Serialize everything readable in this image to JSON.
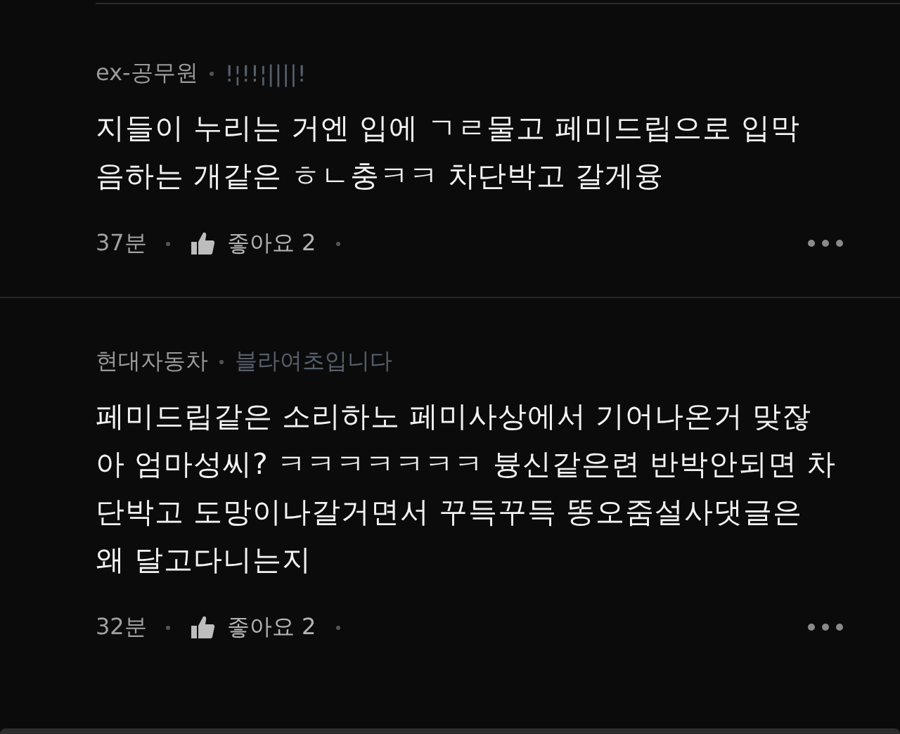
{
  "comments": [
    {
      "author": "ex-공무원",
      "tag": "!¦!!¦||||!",
      "lines": [
        "지들이 누리는 거엔 입에 ㄱㄹ물고 페미드립으로 입막",
        "음하는 개같은 ㅎㄴ충ㅋㅋ 차단박고 갈게융"
      ],
      "time": "37분",
      "likes": "좋아요 2"
    },
    {
      "author": "현대자동차",
      "tag": "블라여초입니다",
      "lines": [
        "페미드립같은 소리하노 페미사상에서 기어나온거 맞잖",
        "아 엄마성씨? ㅋㅋㅋㅋㅋㅋㅋ 븅신같은련 반박안되면 차",
        "단박고 도망이나갈거면서 꾸득꾸득 똥오줌설사댓글은",
        "왜 달고다니는지"
      ],
      "time": "32분",
      "likes": "좋아요 2"
    }
  ]
}
